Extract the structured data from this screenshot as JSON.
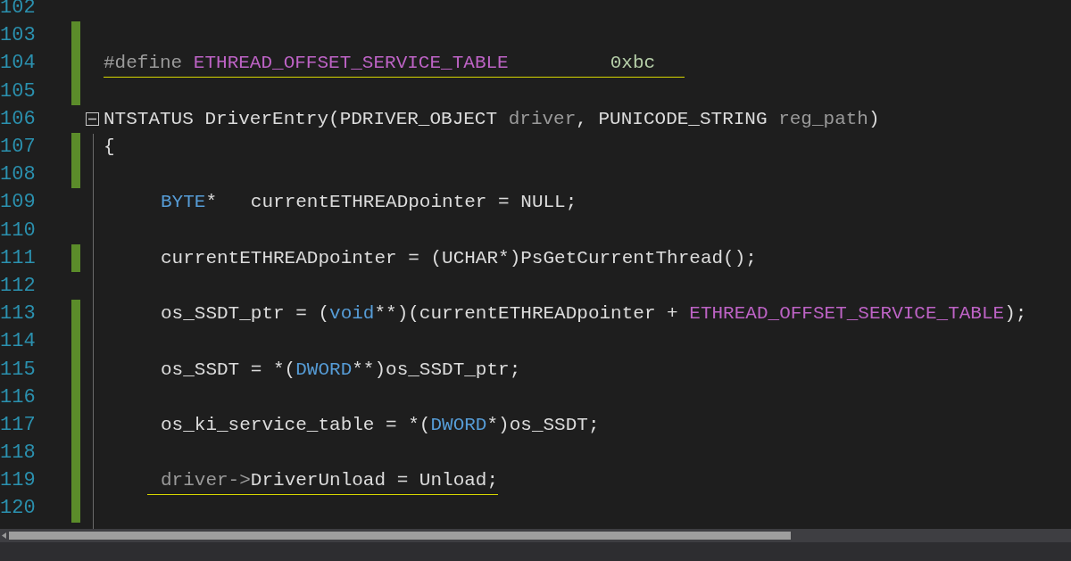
{
  "lines": [
    {
      "number": "102",
      "changed": false
    },
    {
      "number": "103",
      "changed": true
    },
    {
      "number": "104",
      "changed": true,
      "underlined": true,
      "tokens": [
        {
          "text": "#define ",
          "kind": "directive"
        },
        {
          "text": "ETHREAD_OFFSET_SERVICE_TABLE",
          "kind": "macro"
        },
        {
          "text": "0xbc",
          "kind": "number",
          "gap": true
        }
      ]
    },
    {
      "number": "105",
      "changed": true
    },
    {
      "number": "106",
      "changed": false,
      "fold": {
        "expanded": true
      },
      "tokens": [
        {
          "text": "NTSTATUS DriverEntry(PDRIVER_OBJECT ",
          "kind": "plain"
        },
        {
          "text": "driver",
          "kind": "param"
        },
        {
          "text": ", PUNICODE_STRING ",
          "kind": "plain"
        },
        {
          "text": "reg_path",
          "kind": "param"
        },
        {
          "text": ")",
          "kind": "plain"
        }
      ]
    },
    {
      "number": "107",
      "changed": true,
      "tokens": [
        {
          "text": "{",
          "kind": "plain"
        }
      ]
    },
    {
      "number": "108",
      "changed": true
    },
    {
      "number": "109",
      "changed": false,
      "indented": true,
      "tokens": [
        {
          "text": "BYTE",
          "kind": "type"
        },
        {
          "text": "*   currentETHREADpointer = NULL;",
          "kind": "plain"
        }
      ]
    },
    {
      "number": "110",
      "changed": false
    },
    {
      "number": "111",
      "changed": true,
      "indented": true,
      "tokens": [
        {
          "text": "currentETHREADpointer = (UCHAR*)PsGetCurrentThread();",
          "kind": "plain"
        }
      ]
    },
    {
      "number": "112",
      "changed": false
    },
    {
      "number": "113",
      "changed": true,
      "indented": true,
      "tokens": [
        {
          "text": "os_SSDT_ptr = (",
          "kind": "plain"
        },
        {
          "text": "void",
          "kind": "type"
        },
        {
          "text": "**)(currentETHREADpointer + ",
          "kind": "plain"
        },
        {
          "text": "ETHREAD_OFFSET_SERVICE_TABLE",
          "kind": "macro"
        },
        {
          "text": ");",
          "kind": "plain"
        }
      ]
    },
    {
      "number": "114",
      "changed": true
    },
    {
      "number": "115",
      "changed": true,
      "indented": true,
      "tokens": [
        {
          "text": "os_SSDT = *(",
          "kind": "plain"
        },
        {
          "text": "DWORD",
          "kind": "type"
        },
        {
          "text": "**)os_SSDT_ptr;",
          "kind": "plain"
        }
      ]
    },
    {
      "number": "116",
      "changed": true
    },
    {
      "number": "117",
      "changed": true,
      "indented": true,
      "tokens": [
        {
          "text": "os_ki_service_table = *(",
          "kind": "plain"
        },
        {
          "text": "DWORD",
          "kind": "type"
        },
        {
          "text": "*)os_SSDT;",
          "kind": "plain"
        }
      ]
    },
    {
      "number": "118",
      "changed": true
    },
    {
      "number": "119",
      "changed": true,
      "indented": true,
      "underlined": true,
      "tokens": [
        {
          "text": "driver->",
          "kind": "param"
        },
        {
          "text": "DriverUnload = Unload;",
          "kind": "plain"
        }
      ]
    },
    {
      "number": "120",
      "changed": true
    }
  ]
}
